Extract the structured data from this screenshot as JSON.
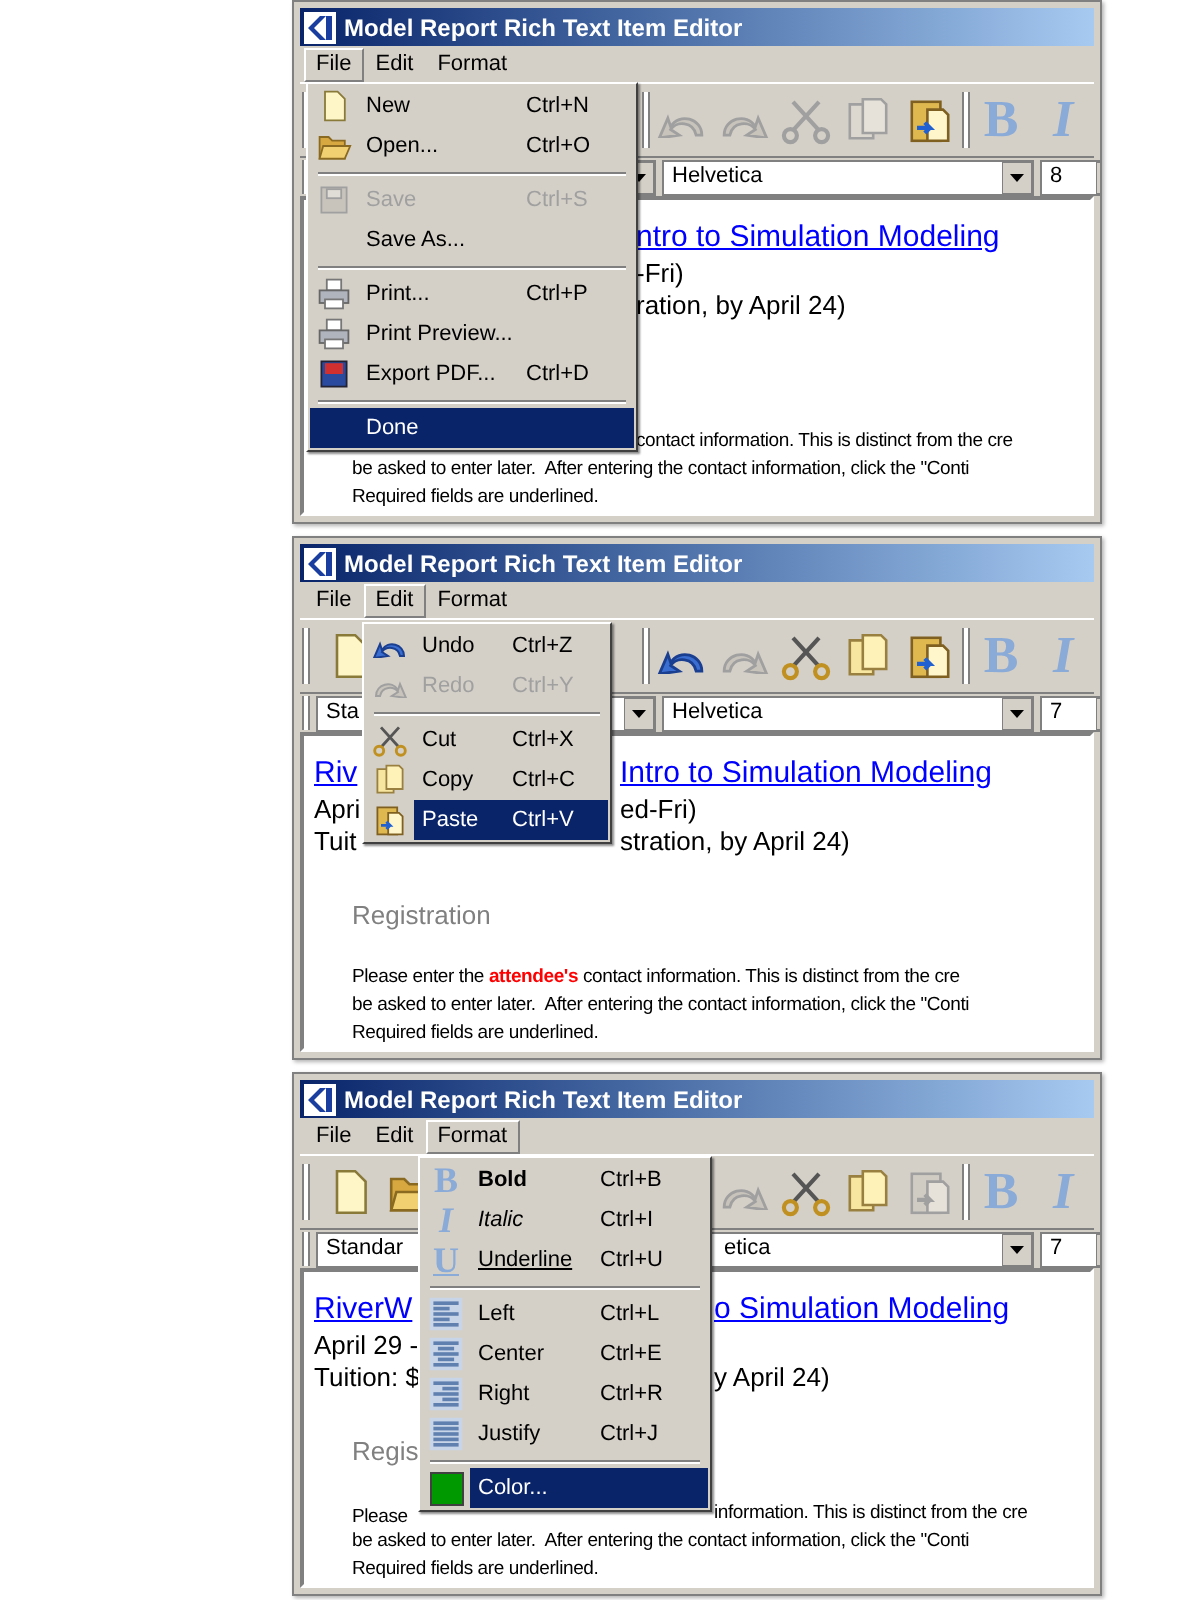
{
  "panels": [
    {
      "title": "Model Report Rich Text Item Editor",
      "menubar": [
        {
          "label": "File",
          "selected": true
        },
        {
          "label": "Edit",
          "selected": false
        },
        {
          "label": "Format",
          "selected": false
        }
      ],
      "toolbar": {
        "edit_tools": [
          {
            "kind": "undo",
            "disabled": true
          },
          {
            "kind": "redo",
            "disabled": true
          },
          {
            "kind": "cut",
            "disabled": true
          },
          {
            "kind": "copy",
            "disabled": true
          },
          {
            "kind": "paste",
            "disabled": false
          }
        ],
        "style_tools": [
          {
            "kind": "bold",
            "glyph": "B"
          },
          {
            "kind": "italic",
            "glyph": "I"
          }
        ]
      },
      "format_bar": {
        "font": "Helvetica",
        "size": "8"
      },
      "document": {
        "title": {
          "right": "ntro to Simulation Modeling"
        },
        "dates": {
          "right": "-Fri)"
        },
        "tuition": {
          "right": "ration, by April 24)"
        },
        "paragraph": [
          {
            "right": "contact information. This is distinct from the cre"
          },
          {
            "left": "be asked to enter later.  After entering the contact information, click the \"Conti"
          },
          {
            "left": "Required fields are underlined."
          }
        ]
      },
      "menu": {
        "kind": "file",
        "items": [
          {
            "kind": "new",
            "label": "New",
            "shortcut": "Ctrl+N",
            "disabled": false,
            "selected": false
          },
          {
            "kind": "open",
            "label": "Open...",
            "shortcut": "Ctrl+O",
            "disabled": false,
            "selected": false
          },
          {
            "kind": "separator"
          },
          {
            "kind": "save",
            "label": "Save",
            "shortcut": "Ctrl+S",
            "disabled": true,
            "selected": false
          },
          {
            "kind": "plain",
            "label": "Save As...",
            "disabled": false,
            "selected": false
          },
          {
            "kind": "separator"
          },
          {
            "kind": "print",
            "label": "Print...",
            "shortcut": "Ctrl+P",
            "disabled": false,
            "selected": false
          },
          {
            "kind": "print",
            "label": "Print Preview...",
            "disabled": false,
            "selected": false
          },
          {
            "kind": "pdf",
            "label": "Export PDF...",
            "shortcut": "Ctrl+D",
            "disabled": false,
            "selected": false
          },
          {
            "kind": "separator"
          },
          {
            "kind": "plain",
            "label": "Done",
            "disabled": false,
            "selected": true
          }
        ]
      }
    },
    {
      "title": "Model Report Rich Text Item Editor",
      "menubar": [
        {
          "label": "File",
          "selected": false
        },
        {
          "label": "Edit",
          "selected": true
        },
        {
          "label": "Format",
          "selected": false
        }
      ],
      "toolbar": {
        "file_tools": [
          {
            "kind": "new",
            "disabled": false
          }
        ],
        "edit_tools": [
          {
            "kind": "undo",
            "disabled": false
          },
          {
            "kind": "redo",
            "disabled": true
          },
          {
            "kind": "cut",
            "disabled": false
          },
          {
            "kind": "copy",
            "disabled": false
          },
          {
            "kind": "paste",
            "disabled": false
          }
        ],
        "style_tools": [
          {
            "kind": "bold",
            "glyph": "B"
          },
          {
            "kind": "italic",
            "glyph": "I"
          }
        ]
      },
      "format_bar": {
        "style": "Sta",
        "font": "Helvetica",
        "size": "7"
      },
      "document": {
        "title": {
          "left": "Riv",
          "right": "Intro to Simulation Modeling"
        },
        "dates": {
          "left": "Apri",
          "right": "ed-Fri)"
        },
        "tuition": {
          "left": "Tuit",
          "right": "stration, by April 24)"
        },
        "heading": {
          "left": "Registration"
        },
        "paragraph": [
          {
            "left": "Please enter the **attendee's** contact information. This is distinct from the cre"
          },
          {
            "left": "be asked to enter later.  After entering the contact information, click the \"Conti"
          },
          {
            "left": "Required fields are underlined."
          }
        ]
      },
      "menu": {
        "kind": "edit",
        "items": [
          {
            "kind": "undo",
            "label": "Undo",
            "shortcut": "Ctrl+Z",
            "disabled": false,
            "selected": false
          },
          {
            "kind": "redo",
            "label": "Redo",
            "shortcut": "Ctrl+Y",
            "disabled": true,
            "selected": false
          },
          {
            "kind": "separator"
          },
          {
            "kind": "cut",
            "label": "Cut",
            "shortcut": "Ctrl+X",
            "disabled": false,
            "selected": false
          },
          {
            "kind": "copy",
            "label": "Copy",
            "shortcut": "Ctrl+C",
            "disabled": false,
            "selected": false
          },
          {
            "kind": "paste",
            "label": "Paste",
            "shortcut": "Ctrl+V",
            "disabled": false,
            "selected": true
          }
        ]
      }
    },
    {
      "title": "Model Report Rich Text Item Editor",
      "menubar": [
        {
          "label": "File",
          "selected": false
        },
        {
          "label": "Edit",
          "selected": false
        },
        {
          "label": "Format",
          "selected": true
        }
      ],
      "toolbar": {
        "file_tools": [
          {
            "kind": "new",
            "disabled": false
          },
          {
            "kind": "open",
            "disabled": false
          }
        ],
        "edit_tools": [
          {
            "kind": "redo",
            "disabled": true
          },
          {
            "kind": "cut",
            "disabled": false
          },
          {
            "kind": "copy",
            "disabled": false
          },
          {
            "kind": "paste",
            "disabled": true
          }
        ],
        "style_tools": [
          {
            "kind": "bold",
            "glyph": "B"
          },
          {
            "kind": "italic",
            "glyph": "I"
          }
        ]
      },
      "format_bar": {
        "style": "Standar",
        "font": "etica",
        "size": "7"
      },
      "document": {
        "title": {
          "left": "RiverW",
          "right": "o Simulation Modeling"
        },
        "dates": {
          "left": "April 29 -"
        },
        "tuition": {
          "left": "Tuition: $",
          "right": "y April 24)"
        },
        "heading": {
          "left": "Regis"
        },
        "paragraph": [
          {
            "left": "Please",
            "right": "information. This is distinct from the cre"
          },
          {
            "left": "be asked to enter later.  After entering the contact information, click the \"Conti"
          },
          {
            "left": "Required fields are underlined."
          }
        ]
      },
      "menu": {
        "kind": "format",
        "items": [
          {
            "kind": "bold",
            "glyph": "B",
            "label": "Bold",
            "shortcut": "Ctrl+B",
            "disabled": false,
            "selected": false
          },
          {
            "kind": "italic",
            "glyph": "I",
            "label": "Italic",
            "shortcut": "Ctrl+I",
            "disabled": false,
            "selected": false
          },
          {
            "kind": "underline",
            "glyph": "U",
            "label": "Underline",
            "shortcut": "Ctrl+U",
            "disabled": false,
            "selected": false
          },
          {
            "kind": "separator"
          },
          {
            "kind": "align-left",
            "label": "Left",
            "shortcut": "Ctrl+L",
            "disabled": false,
            "selected": false
          },
          {
            "kind": "align-center",
            "label": "Center",
            "shortcut": "Ctrl+E",
            "disabled": false,
            "selected": false
          },
          {
            "kind": "align-right",
            "label": "Right",
            "shortcut": "Ctrl+R",
            "disabled": false,
            "selected": false
          },
          {
            "kind": "justify",
            "label": "Justify",
            "shortcut": "Ctrl+J",
            "disabled": false,
            "selected": false
          },
          {
            "kind": "separator"
          },
          {
            "kind": "color",
            "label": "Color...",
            "color": "#009900",
            "disabled": false,
            "selected": true
          }
        ]
      }
    }
  ]
}
